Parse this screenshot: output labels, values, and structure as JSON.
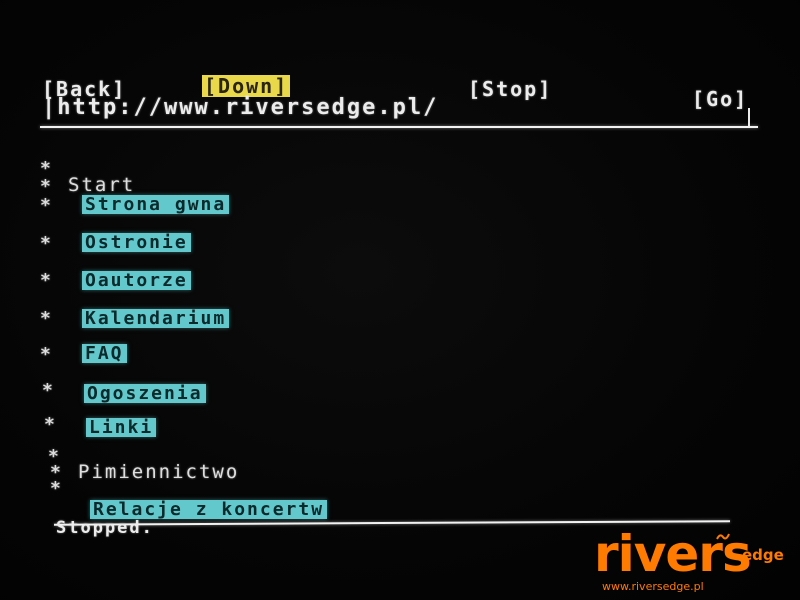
{
  "toolbar": {
    "back": "[Back]",
    "down": "[Down]",
    "stop": "[Stop]",
    "go": "[Go]"
  },
  "address": {
    "url": "|http://www.riversedge.pl/"
  },
  "content": {
    "star": "*",
    "section_start": "Start",
    "section_pismiennictwo": "Pimiennictwo",
    "links": [
      {
        "label": "Strona gwna"
      },
      {
        "label": "Ostronie"
      },
      {
        "label": "Oautorze"
      },
      {
        "label": "Kalendarium"
      },
      {
        "label": "FAQ"
      },
      {
        "label": "Ogoszenia"
      },
      {
        "label": "Linki"
      },
      {
        "label": "Relacje z koncertw"
      }
    ]
  },
  "status": {
    "text": "Stopped."
  },
  "watermark": {
    "main": "rivers",
    "sub": "edge",
    "url": "www.riversedge.pl",
    "color": "#ff7a00"
  },
  "colors": {
    "background": "#050505",
    "text": "#ececec",
    "link_highlight": "#62c8cc",
    "active_button": "#e8d84a"
  }
}
